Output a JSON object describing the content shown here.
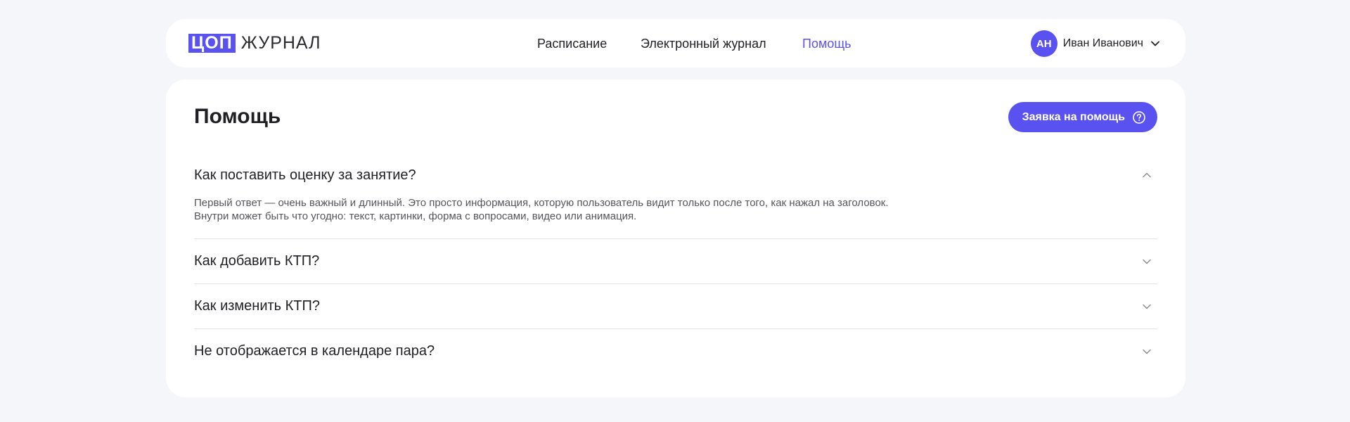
{
  "logo": {
    "box_text": "ЦОП",
    "word_text": "ЖУРНАЛ"
  },
  "nav": {
    "items": [
      {
        "label": "Расписание"
      },
      {
        "label": "Электронный журнал"
      },
      {
        "label": "Помощь",
        "active": true
      }
    ]
  },
  "user": {
    "initials": "АН",
    "name": "Иван Иванович",
    "chevron_icon": "chevron-down-icon"
  },
  "page": {
    "title": "Помощь",
    "help_button": {
      "label": "Заявка на помощь",
      "icon": "question-circle-icon"
    }
  },
  "faq": {
    "items": [
      {
        "question": "Как поставить оценку за занятие?",
        "answer": "Первый ответ — очень важный и длинный. Это просто информация, которую пользователь видит только после того, как нажал на заголовок. Внутри может быть что угодно: текст, картинки, форма с вопросами, видео или анимация.",
        "expanded": true,
        "icon": "chevron-up-icon"
      },
      {
        "question": "Как добавить КТП?",
        "expanded": false,
        "icon": "chevron-down-icon"
      },
      {
        "question": "Как изменить КТП?",
        "expanded": false,
        "icon": "chevron-down-icon"
      },
      {
        "question": "Не отображается в календаре пара?",
        "expanded": false,
        "icon": "chevron-down-icon"
      }
    ]
  },
  "colors": {
    "accent": "#5a52f0",
    "background": "#f5f6fa",
    "surface": "#ffffff",
    "divider": "#e3e4e8"
  }
}
